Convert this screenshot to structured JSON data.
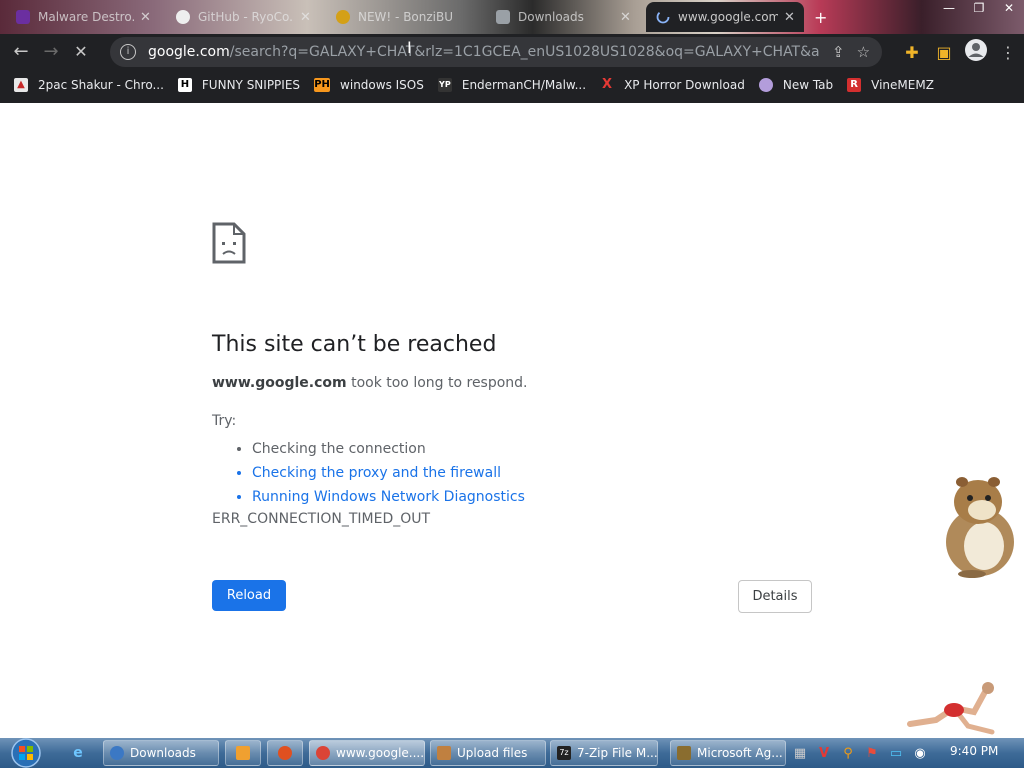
{
  "tabs": [
    {
      "title": "Malware Destro...",
      "color": "#6b2fa0",
      "active": false
    },
    {
      "title": "GitHub - RyoCo...",
      "color": "#eeeeee",
      "active": false
    },
    {
      "title": "NEW! - BonziBU...",
      "color": "#d4a017",
      "active": false
    },
    {
      "title": "Downloads",
      "color": "#9aa0a6",
      "active": false
    },
    {
      "title": "www.google.com",
      "color": "#8ab4f8",
      "active": true
    }
  ],
  "address": {
    "host": "google.com",
    "rest": "/search?q=GALAXY+CHAT&rlz=1C1GCEA_enUS1028US1028&oq=GALAXY+CHAT&aqs=chrom..."
  },
  "bookmarks": [
    {
      "label": "2pac Shakur - Chro...",
      "badge": "",
      "color": "#e8e8e8"
    },
    {
      "label": "FUNNY SNIPPIES",
      "badge": "H",
      "color": "#ffffff"
    },
    {
      "label": "windows ISOS",
      "badge": "PH",
      "color": "#f7971d"
    },
    {
      "label": "EndermanCH/Malw...",
      "badge": "YP",
      "color": "#333333"
    },
    {
      "label": "XP Horror Download",
      "badge": "X",
      "color": "#e53935"
    },
    {
      "label": "New Tab",
      "badge": "",
      "color": "#b39ddb"
    },
    {
      "label": "VineMEMZ",
      "badge": "R",
      "color": "#d32f2f"
    }
  ],
  "error": {
    "title": "This site can’t be reached",
    "host": "www.google.com",
    "message": " took too long to respond.",
    "try_label": "Try:",
    "suggestions": [
      {
        "text": "Checking the connection",
        "link": false
      },
      {
        "text": "Checking the proxy and the firewall",
        "link": true
      },
      {
        "text": "Running Windows Network Diagnostics",
        "link": true
      }
    ],
    "code": "ERR_CONNECTION_TIMED_OUT",
    "reload_label": "Reload",
    "details_label": "Details"
  },
  "taskbar": {
    "items": [
      {
        "label": "Downloads",
        "color": "#3b78c4"
      },
      {
        "label": "",
        "color": "#f0a030"
      },
      {
        "label": "",
        "color": "#e05020"
      },
      {
        "label": "www.google....",
        "color": "#db4437"
      },
      {
        "label": "Upload files",
        "color": "#c08040"
      },
      {
        "label": "7-Zip File M...",
        "color": "#222222"
      },
      {
        "label": "Microsoft Ag...",
        "color": "#8a6d2f"
      }
    ],
    "clock": "9:40 PM"
  }
}
